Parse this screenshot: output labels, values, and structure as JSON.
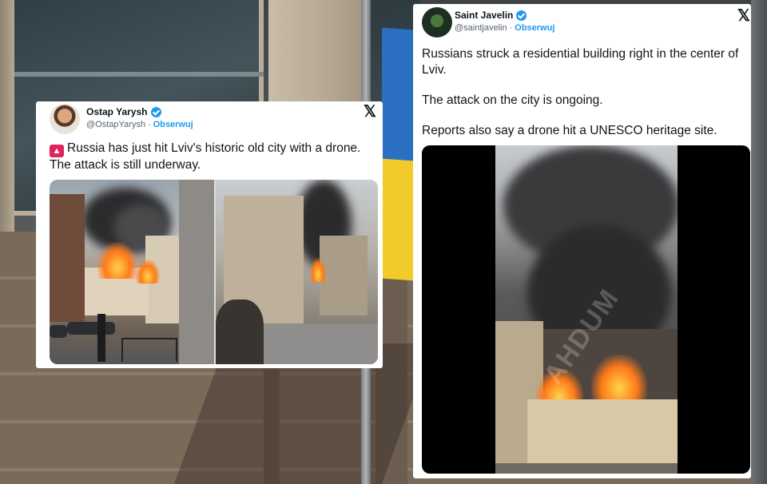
{
  "tweet1": {
    "author": {
      "name": "Ostap Yarysh",
      "handle": "@OstapYarysh",
      "follow_label": "Obserwuj"
    },
    "separator": "·",
    "emoji_label": "🚨",
    "text": "Russia has just hit Lviv's historic old city with a drone. The attack is still underway.",
    "x_logo": "𝕏",
    "media_count": 2
  },
  "tweet2": {
    "author": {
      "name": "Saint Javelin",
      "handle": "@saintjavelin",
      "follow_label": "Obserwuj"
    },
    "separator": "·",
    "paragraphs": [
      "Russians struck a residential building right in the center of Lviv.",
      "The attack on the city is ongoing.",
      "Reports also say a drone hit a UNESCO heritage site."
    ],
    "x_logo": "𝕏",
    "video_watermark": "AHDUM"
  },
  "colors": {
    "verified": "#1d9bf0",
    "follow": "#1d9bf0",
    "text": "#0f1419",
    "secondary": "#536471",
    "flag_blue": "#2a6fc2",
    "flag_yellow": "#f0cb2a"
  }
}
